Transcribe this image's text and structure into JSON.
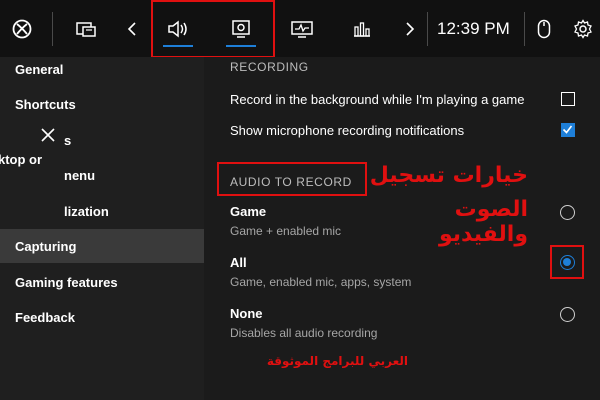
{
  "topbar": {
    "time": "12:39 PM",
    "icons": [
      "xbox-logo",
      "widget-store",
      "chevron-left",
      "audio",
      "capture",
      "performance",
      "resources",
      "chevron-right",
      "mouse",
      "settings"
    ]
  },
  "sidebar": {
    "items": [
      {
        "label": "General"
      },
      {
        "label": "Shortcuts"
      },
      {
        "label": "s"
      },
      {
        "label": "ktop or"
      },
      {
        "label": "nenu"
      },
      {
        "label": "lization"
      },
      {
        "label": "Capturing"
      },
      {
        "label": "Gaming features"
      },
      {
        "label": "Feedback"
      }
    ]
  },
  "main": {
    "recording_header": "RECORDING",
    "record_background_label": "Record in the background while I'm playing a game",
    "record_background_checked": false,
    "mic_notifications_label": "Show microphone recording notifications",
    "mic_notifications_checked": true,
    "audio_header": "AUDIO TO RECORD",
    "options": [
      {
        "title": "Game",
        "desc": "Game + enabled mic",
        "selected": false
      },
      {
        "title": "All",
        "desc": "Game, enabled mic, apps, system",
        "selected": true
      },
      {
        "title": "None",
        "desc": "Disables all audio recording",
        "selected": false
      }
    ]
  },
  "annotations": {
    "line1": "خيارات تسجيل",
    "line2": "الصوت والفيديو",
    "footer": "العربي للبرامج الموثوقة"
  },
  "colors": {
    "accent": "#1e7fd8",
    "annotation_red": "#e01010"
  }
}
